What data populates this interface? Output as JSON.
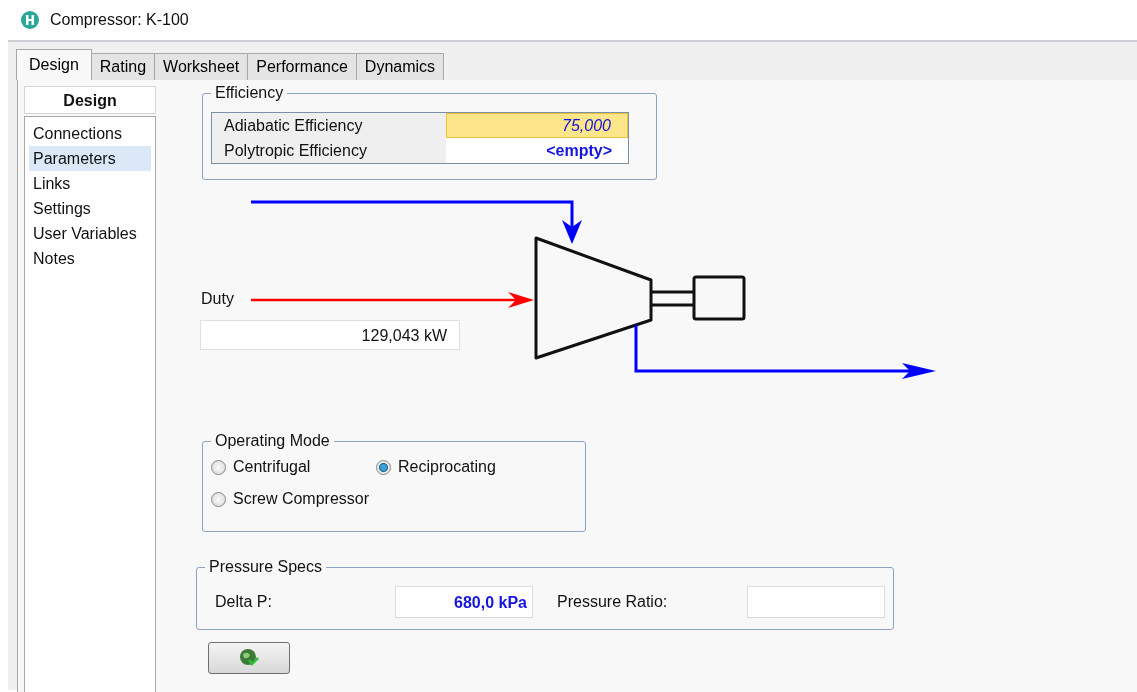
{
  "window": {
    "title": "Compressor: K-100"
  },
  "tabs": [
    {
      "label": "Design",
      "selected": true
    },
    {
      "label": "Rating",
      "selected": false
    },
    {
      "label": "Worksheet",
      "selected": false
    },
    {
      "label": "Performance",
      "selected": false
    },
    {
      "label": "Dynamics",
      "selected": false
    }
  ],
  "sidebar": {
    "header": "Design",
    "items": [
      {
        "label": "Connections",
        "selected": false
      },
      {
        "label": "Parameters",
        "selected": true
      },
      {
        "label": "Links",
        "selected": false
      },
      {
        "label": "Settings",
        "selected": false
      },
      {
        "label": "User Variables",
        "selected": false
      },
      {
        "label": "Notes",
        "selected": false
      }
    ]
  },
  "efficiency": {
    "title": "Efficiency",
    "rows": [
      {
        "label": "Adiabatic Efficiency",
        "value": "75,000",
        "kind": "specified"
      },
      {
        "label": "Polytropic Efficiency",
        "value": "<empty>",
        "kind": "empty"
      }
    ]
  },
  "duty": {
    "label": "Duty",
    "value": "129,043 kW"
  },
  "operating_mode": {
    "title": "Operating Mode",
    "options": [
      {
        "label": "Centrifugal",
        "selected": false
      },
      {
        "label": "Reciprocating",
        "selected": true
      },
      {
        "label": "Screw Compressor",
        "selected": false
      }
    ]
  },
  "pressure_specs": {
    "title": "Pressure Specs",
    "fields": [
      {
        "label": "Delta P:",
        "value": "680,0 kPa"
      },
      {
        "label": "Pressure Ratio:"
      }
    ]
  }
}
